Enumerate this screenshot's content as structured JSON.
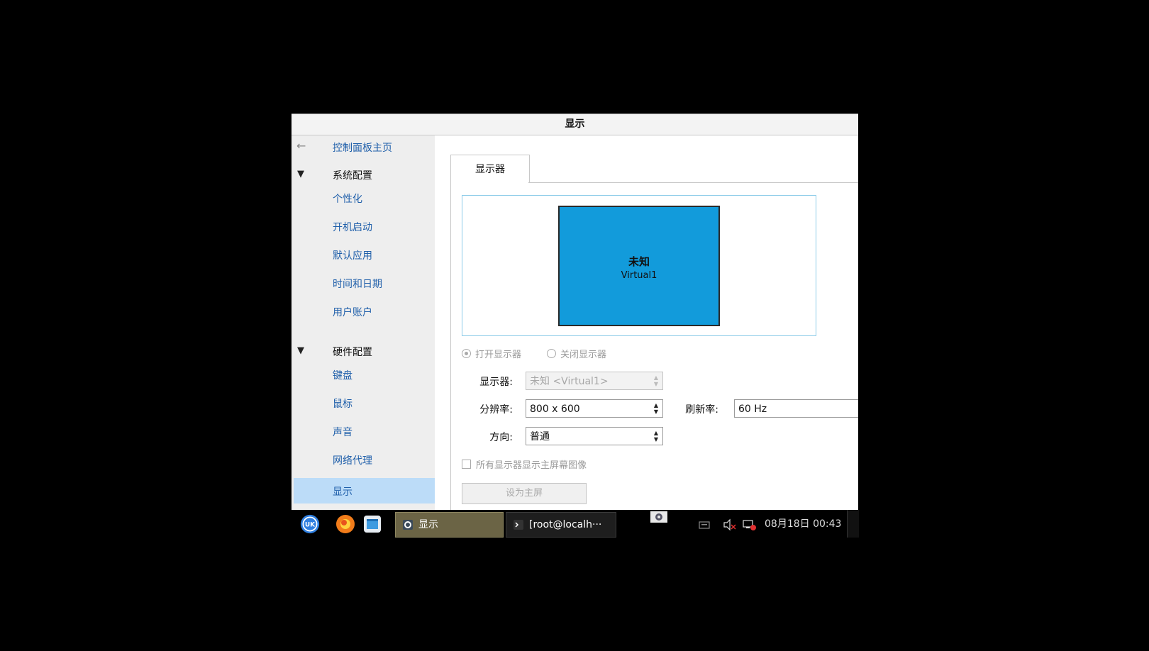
{
  "window": {
    "title": "显示"
  },
  "sidebar": {
    "home": "控制面板主页",
    "categories": [
      {
        "label": "系统配置",
        "items": [
          "个性化",
          "开机启动",
          "默认应用",
          "时间和日期",
          "用户账户"
        ]
      },
      {
        "label": "硬件配置",
        "items": [
          "键盘",
          "鼠标",
          "声音",
          "网络代理",
          "显示"
        ]
      }
    ],
    "selected": "显示"
  },
  "content": {
    "tab": "显示器",
    "monitor": {
      "name": "未知",
      "id": "Virtual1"
    },
    "radio_on": "打开显示器",
    "radio_off": "关闭显示器",
    "display_label": "显示器:",
    "display_value": "未知 <Virtual1>",
    "resolution_label": "分辨率:",
    "resolution_value": "800 x 600",
    "refresh_label": "刷新率:",
    "refresh_value": "60 Hz",
    "orientation_label": "方向:",
    "orientation_value": "普通",
    "mirror_label": "所有显示器显示主屏幕图像",
    "primary_button": "设为主屏",
    "colors": {
      "monitor": "#129bdb",
      "link": "#1f5faa",
      "selected": "#bcdcf8"
    }
  },
  "taskbar": {
    "tasks": [
      {
        "label": "显示",
        "icon": "settings-icon"
      },
      {
        "label": "[root@localh···",
        "icon": "terminal-icon"
      }
    ],
    "clock": "08月18日 00:43",
    "launcher_icons": [
      "start-menu-icon",
      "firefox-icon",
      "file-manager-icon"
    ]
  }
}
